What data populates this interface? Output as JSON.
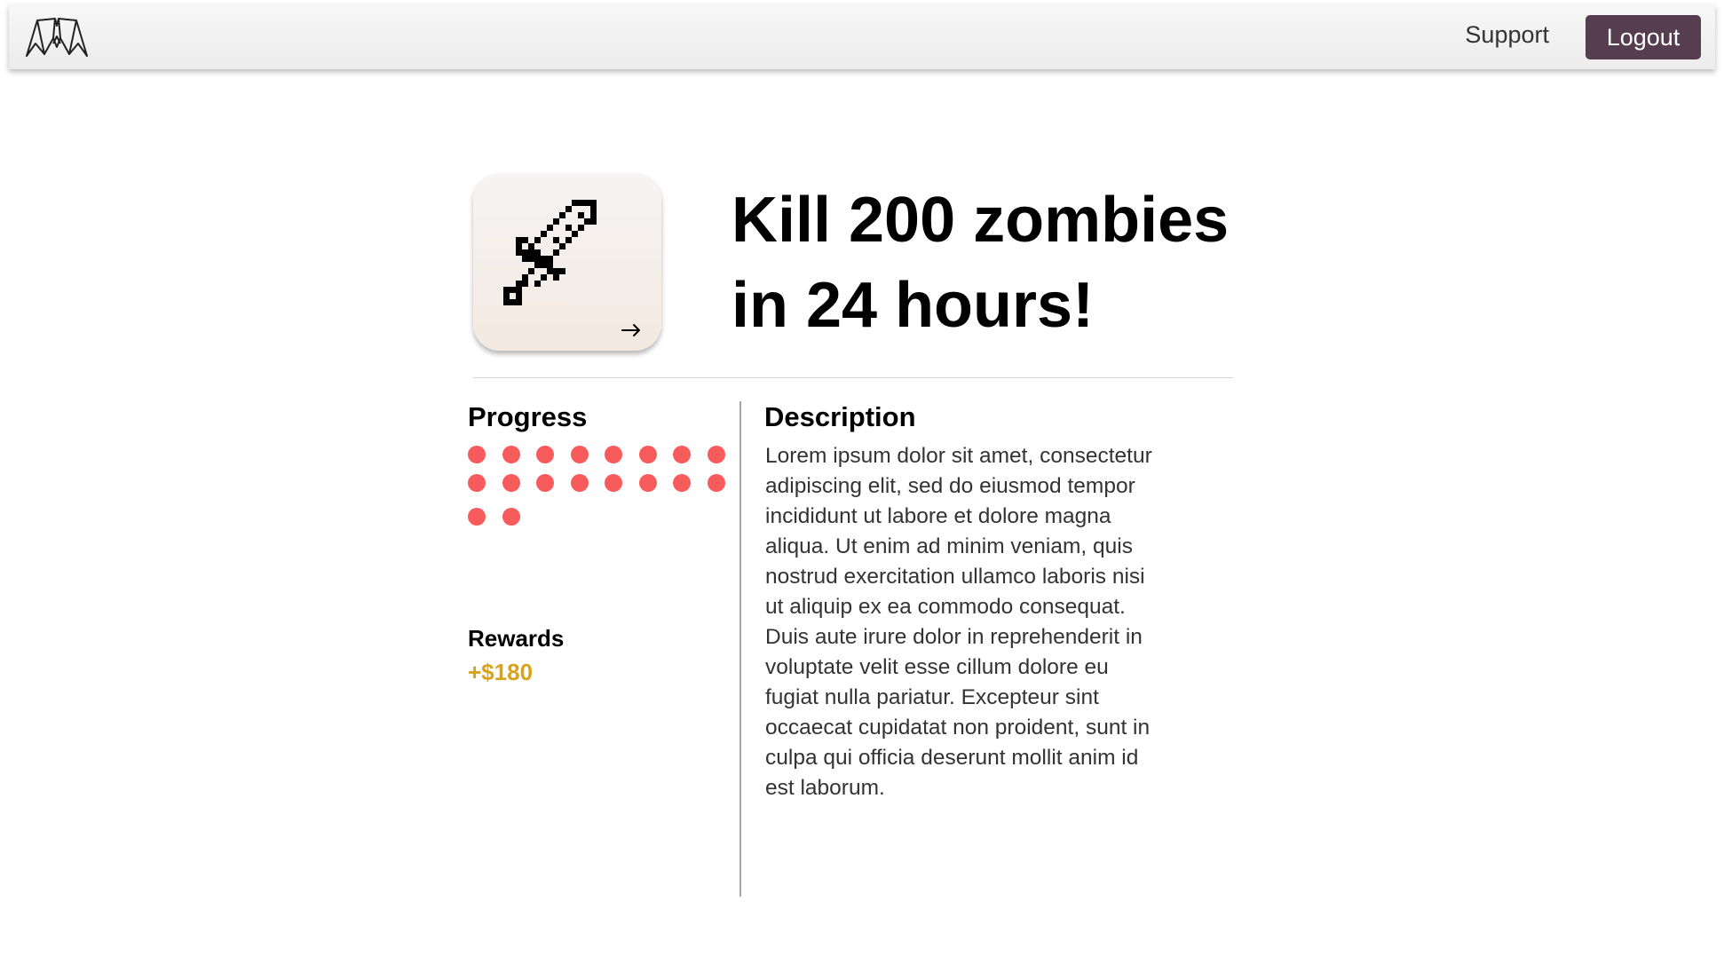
{
  "header": {
    "logo_icon": "bat-wings-logo",
    "support_label": "Support",
    "logout_label": "Logout"
  },
  "quest": {
    "icon": "pixel-sword-icon",
    "arrow_icon": "arrow-right-icon",
    "title": "Kill 200 zombies in 24 hours!"
  },
  "progress": {
    "heading": "Progress",
    "dot_count": 18,
    "dot_color": "#f85b5b"
  },
  "rewards": {
    "heading": "Rewards",
    "value": "+$180",
    "value_color": "#d8a318"
  },
  "description": {
    "heading": "Description",
    "body": "Lorem ipsum dolor sit amet, consectetur adipiscing elit, sed do eiusmod  tempor incididunt ut labore et dolore magna aliqua. Ut enim ad minim  veniam, quis nostrud exercitation ullamco laboris nisi ut aliquip ex ea  commodo consequat. Duis aute irure dolor in reprehenderit in voluptate  velit esse cillum dolore eu fugiat nulla pariatur. Excepteur sint occaecat cupidatat non proident, sunt in culpa qui officia deserunt  mollit anim id est laborum."
  },
  "colors": {
    "logout_bg": "#563e50",
    "accent_gold": "#d8a318"
  }
}
